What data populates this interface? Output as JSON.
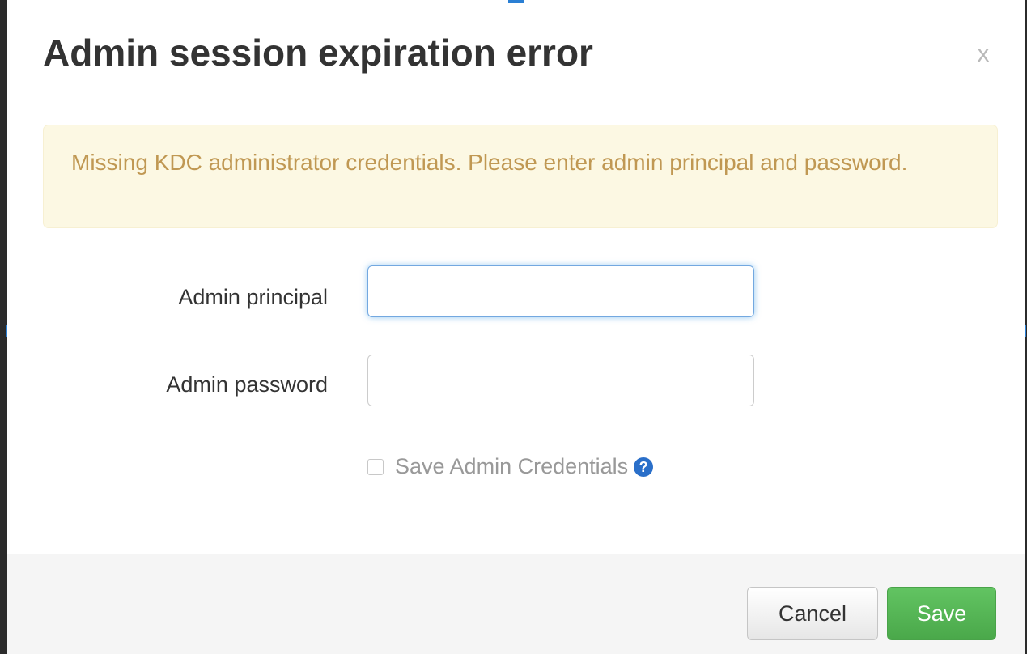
{
  "modal": {
    "title": "Admin session expiration error",
    "close_label": "x"
  },
  "alert": {
    "message": "Missing KDC administrator credentials. Please enter admin principal and password."
  },
  "form": {
    "principal_label": "Admin principal",
    "principal_value": "",
    "password_label": "Admin password",
    "password_value": "",
    "save_credentials_label": "Save Admin Credentials",
    "save_credentials_checked": false,
    "help_icon_glyph": "?"
  },
  "footer": {
    "cancel_label": "Cancel",
    "save_label": "Save"
  },
  "colors": {
    "alert_background": "#fcf8e3",
    "alert_text": "#c09853",
    "save_button": "#5bb75b",
    "help_icon": "#2a6fc9",
    "focus_border": "#66afe9"
  },
  "icons": {
    "close": "close-icon",
    "help": "question-circle-icon",
    "checkbox": "checkbox-icon"
  }
}
